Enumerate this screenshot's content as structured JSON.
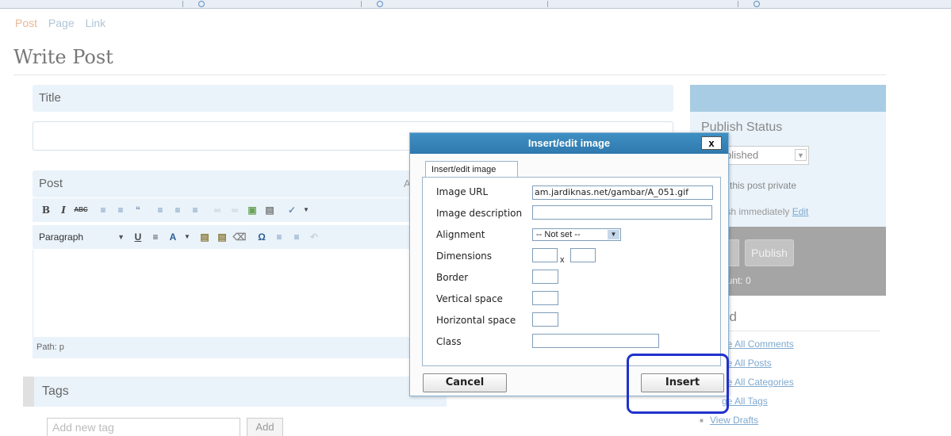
{
  "write_tabs": {
    "post": "Post",
    "page": "Page",
    "link": "Link"
  },
  "page_title": "Write Post",
  "title_box": {
    "heading": "Title"
  },
  "post_box": {
    "heading": "Post",
    "heading_extra": "A",
    "format_select": "Paragraph",
    "path": "Path: p"
  },
  "tags_box": {
    "heading": "Tags",
    "input_placeholder": "Add new tag",
    "add_label": "Add"
  },
  "sidebar": {
    "publish_status": "Publish Status",
    "status_value": "blished",
    "private_text": "p this post private",
    "publish_immediately": "lish immediately",
    "edit_link": "Edit",
    "publish_button": "Publish",
    "word_count": "ount: 0",
    "related_title": "ed",
    "related_items": [
      "ge All Comments",
      "ge All Posts",
      "ge All Categories",
      "ge All Tags",
      "View Drafts"
    ]
  },
  "dialog": {
    "title": "Insert/edit image",
    "close": "x",
    "tab": "Insert/edit image",
    "fields": {
      "image_url_label": "Image URL",
      "image_url_value": "am.jardiknas.net/gambar/A_051.gif",
      "image_description_label": "Image description",
      "alignment_label": "Alignment",
      "alignment_value": "-- Not set --",
      "dimensions_label": "Dimensions",
      "dimensions_sep": "x",
      "border_label": "Border",
      "vertical_space_label": "Vertical space",
      "horizontal_space_label": "Horizontal space",
      "class_label": "Class"
    },
    "cancel_label": "Cancel",
    "insert_label": "Insert"
  },
  "colors": {
    "titlebar": "#3f8fc3",
    "highlight": "#2131cc",
    "link": "#7fa9cf",
    "panel": "#eaf3fa"
  }
}
